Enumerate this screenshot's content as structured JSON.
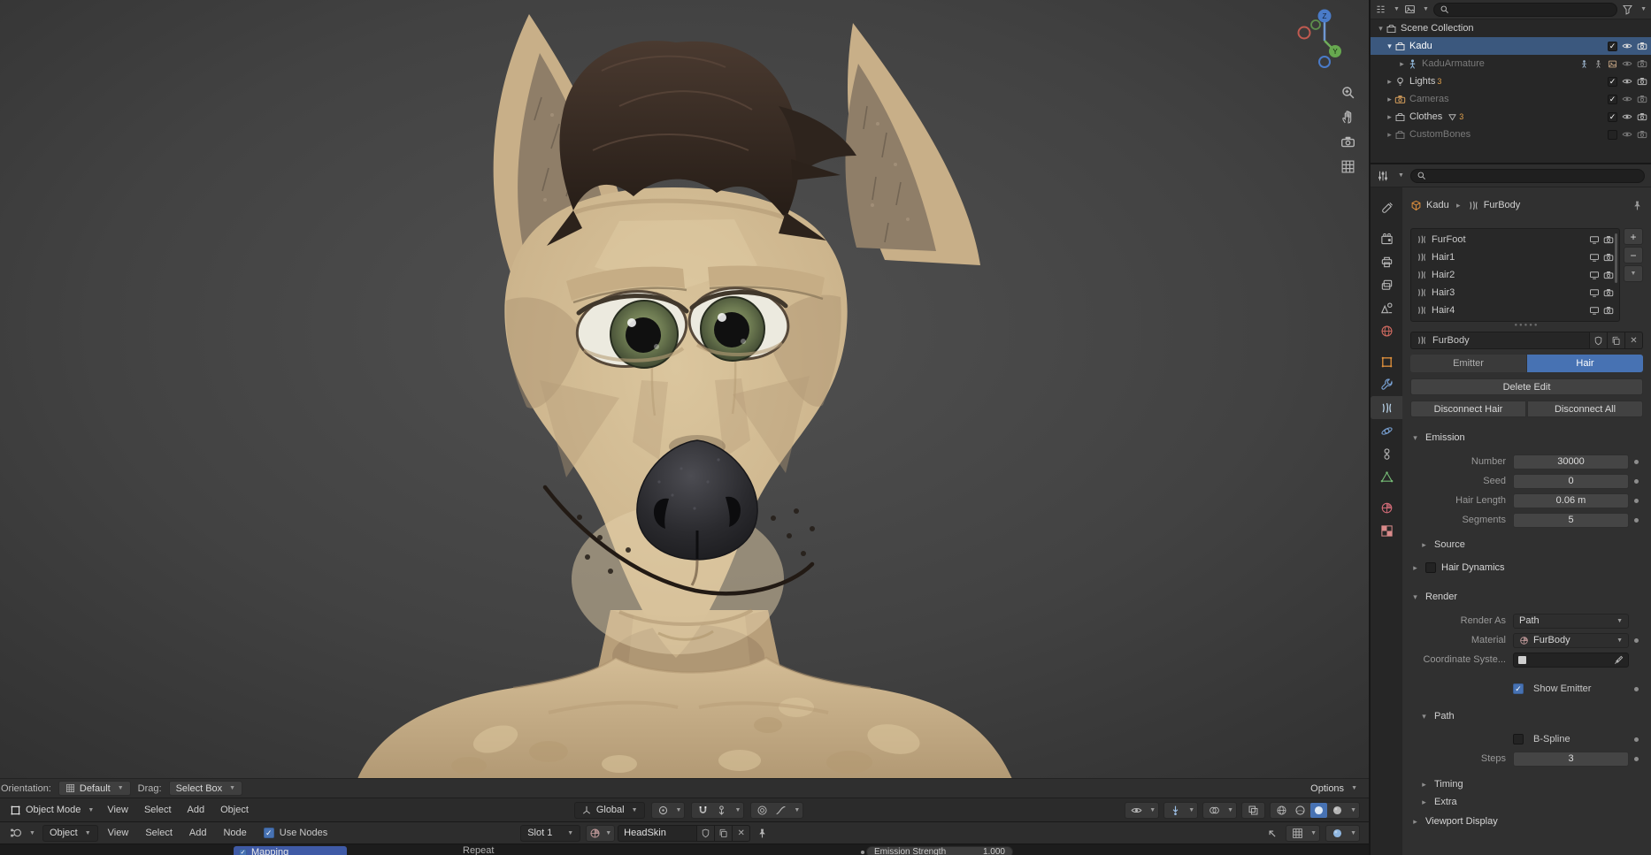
{
  "colors": {
    "accent": "#4772b3",
    "selection_row": "#3b587e",
    "object_orange": "#e0903c",
    "panel": "#303030"
  },
  "viewport": {
    "gizmo": {
      "z_label": "Z",
      "y_label": "Y"
    },
    "tool_footer": {
      "orientation_label": "Orientation:",
      "orientation_value": "Default",
      "drag_label": "Drag:",
      "drag_value": "Select Box",
      "options_label": "Options"
    },
    "header": {
      "mode": "Object Mode",
      "menus": [
        "View",
        "Select",
        "Add",
        "Object"
      ],
      "transform_orientation": "Global"
    }
  },
  "shader": {
    "shader_type": "Object",
    "menus": [
      "View",
      "Select",
      "Add",
      "Node"
    ],
    "use_nodes_label": "Use Nodes",
    "slot_label": "Slot 1",
    "material_name": "HeadSkin",
    "nodes": {
      "mapping_label": "Mapping",
      "repeat_label": "Repeat",
      "emission_strength_label": "Emission Strength",
      "emission_strength_value": "1.000"
    }
  },
  "outliner": {
    "rows": [
      {
        "label": "Scene Collection"
      },
      {
        "label": "Kadu"
      },
      {
        "label": "KaduArmature"
      },
      {
        "label": "Lights",
        "badge": "3"
      },
      {
        "label": "Cameras"
      },
      {
        "label": "Clothes",
        "badge": "3"
      },
      {
        "label": "CustomBones"
      }
    ]
  },
  "properties": {
    "breadcrumb": {
      "object": "Kadu",
      "data": "FurBody"
    },
    "slots": [
      {
        "label": "FurFoot"
      },
      {
        "label": "Hair1"
      },
      {
        "label": "Hair2"
      },
      {
        "label": "Hair3"
      },
      {
        "label": "Hair4"
      }
    ],
    "name_value": "FurBody",
    "tabs": {
      "emitter": "Emitter",
      "hair": "Hair"
    },
    "buttons": {
      "delete_edit": "Delete Edit",
      "disconnect_hair": "Disconnect Hair",
      "disconnect_all": "Disconnect All"
    },
    "sections": {
      "emission": "Emission",
      "source": "Source",
      "hair_dynamics": "Hair Dynamics",
      "render": "Render",
      "path": "Path",
      "timing": "Timing",
      "extra": "Extra",
      "viewport_display": "Viewport Display"
    },
    "emission_fields": [
      {
        "label": "Number",
        "value": "30000"
      },
      {
        "label": "Seed",
        "value": "0"
      },
      {
        "label": "Hair Length",
        "value": "0.06 m"
      },
      {
        "label": "Segments",
        "value": "5"
      }
    ],
    "render_panel": {
      "render_as_label": "Render As",
      "render_as_value": "Path",
      "material_label": "Material",
      "material_value": "FurBody",
      "coordinate_label": "Coordinate Syste...",
      "show_emitter_label": "Show Emitter",
      "bspline_label": "B-Spline",
      "steps_label": "Steps",
      "steps_value": "3"
    }
  }
}
